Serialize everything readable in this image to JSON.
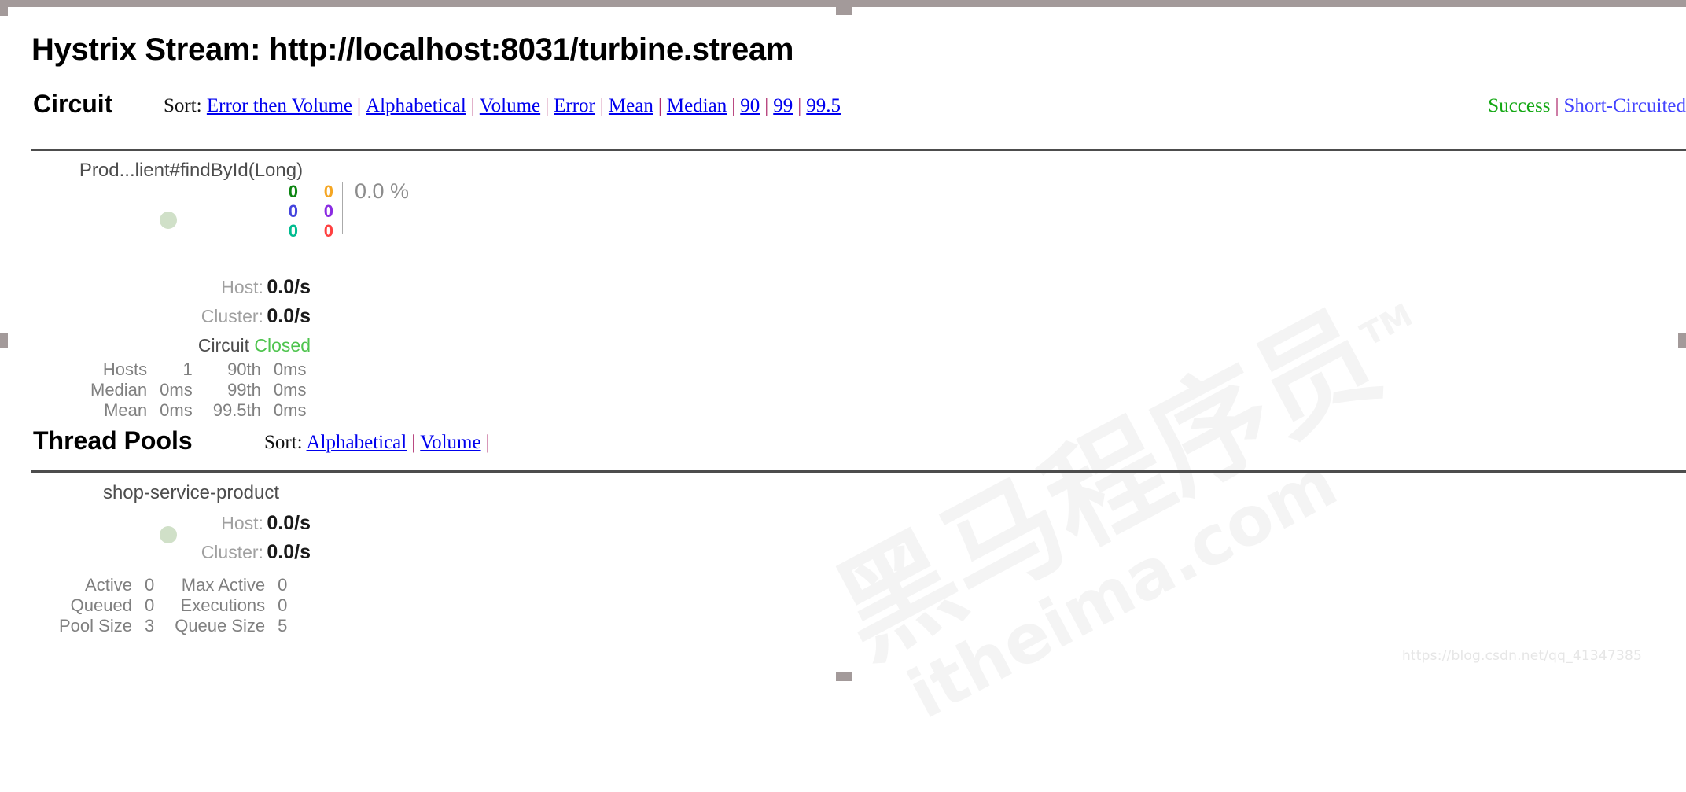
{
  "page": {
    "title": "Hystrix Stream: http://localhost:8031/turbine.stream"
  },
  "circuit_section": {
    "heading": "Circuit",
    "sort_label": "Sort:",
    "sort_options": [
      "Error then Volume",
      "Alphabetical",
      "Volume",
      "Error",
      "Mean",
      "Median",
      "90",
      "99",
      "99.5"
    ],
    "legend": {
      "success": "Success",
      "short_circuited": "Short-Circuited",
      "success_color": "#13a813",
      "short_circuited_color": "#4444ff"
    }
  },
  "circuit_card": {
    "name": "Prod...lient#findById(Long)",
    "counters": {
      "success": "0",
      "short_circuited": "0",
      "timeout": "0",
      "rejected": "0",
      "bad_request": "0",
      "failure": "0"
    },
    "counter_colors": {
      "success": "#0d8512",
      "timeout": "#4444dd",
      "bad_request": "#00bb8f",
      "short_circuited": "#f5a623",
      "rejected": "#8a2be2",
      "failure": "#ff4040"
    },
    "error_percent": "0.0 %",
    "host_label": "Host:",
    "host_rate": "0.0/s",
    "cluster_label": "Cluster:",
    "cluster_rate": "0.0/s",
    "circuit_label": "Circuit",
    "circuit_state": "Closed",
    "circuit_state_color": "#4ec44e",
    "stats": [
      {
        "k": "Hosts",
        "v": "1",
        "k2": "90th",
        "v2": "0ms"
      },
      {
        "k": "Median",
        "v": "0ms",
        "k2": "99th",
        "v2": "0ms"
      },
      {
        "k": "Mean",
        "v": "0ms",
        "k2": "99.5th",
        "v2": "0ms"
      }
    ]
  },
  "threadpool_section": {
    "heading": "Thread Pools",
    "sort_label": "Sort:",
    "sort_options": [
      "Alphabetical",
      "Volume"
    ]
  },
  "threadpool_card": {
    "name": "shop-service-product",
    "host_label": "Host:",
    "host_rate": "0.0/s",
    "cluster_label": "Cluster:",
    "cluster_rate": "0.0/s",
    "stats": [
      {
        "k": "Active",
        "v": "0",
        "k2": "Max Active",
        "v2": "0"
      },
      {
        "k": "Queued",
        "v": "0",
        "k2": "Executions",
        "v2": "0"
      },
      {
        "k": "Pool Size",
        "v": "3",
        "k2": "Queue Size",
        "v2": "5"
      }
    ]
  },
  "watermark": {
    "line1": "黑马程序员",
    "tm": "TM",
    "line2": "itheima.com",
    "url": "https://blog.csdn.net/qq_41347385"
  }
}
